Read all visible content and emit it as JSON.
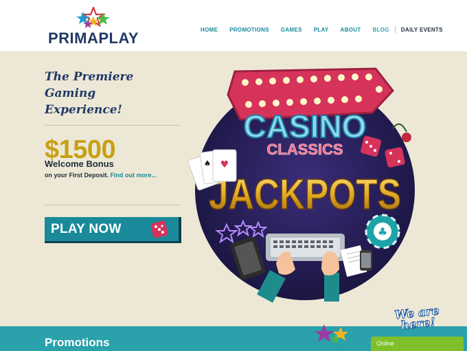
{
  "header": {
    "logo_text": "PRIMAPLAY",
    "nav": [
      "HOME",
      "PROMOTIONS",
      "GAMES",
      "PLAY",
      "ABOUT",
      "BLOG",
      "DAILY EVENTS"
    ]
  },
  "hero": {
    "title_lines": [
      "The Premiere",
      "Gaming",
      "Experience!"
    ],
    "bonus_amount": "$1500",
    "bonus_label": "Welcome Bonus",
    "bonus_sub": "on your First Deposit.",
    "bonus_link": "Find out more...",
    "cta_label": "PLAY NOW",
    "art": {
      "casino": "CASINO",
      "classics": "CLASSICS",
      "jackpots": "JACKPOTS"
    }
  },
  "promotions": {
    "heading": "Promotions"
  },
  "chat": {
    "badge": "We are here!",
    "status": "Online"
  },
  "colors": {
    "brand_navy": "#213a66",
    "brand_teal": "#1a8a9a",
    "accent_gold": "#c8a012",
    "background": "#ede8d6",
    "chat_green": "#7fbf2b"
  },
  "icons": {
    "logo": "star-cluster-icon",
    "cta": "dice-icon"
  }
}
